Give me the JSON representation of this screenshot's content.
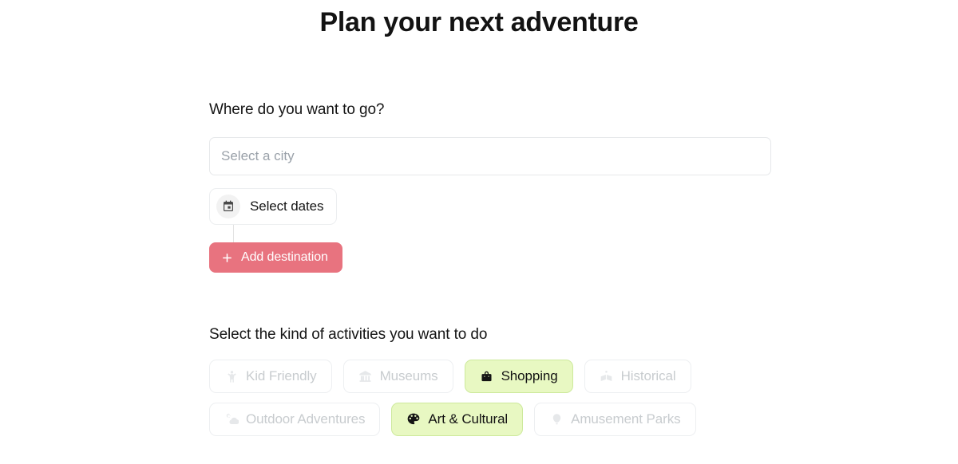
{
  "page": {
    "title": "Plan your next adventure"
  },
  "destination": {
    "label": "Where do you want to go?",
    "city_input": {
      "value": "",
      "placeholder": "Select a city"
    },
    "select_dates": {
      "label": "Select dates",
      "icon": "calendar-icon"
    },
    "add_destination": {
      "label": "Add destination",
      "icon": "plus-icon",
      "color": "#e8737f",
      "text_color": "#ffffff"
    }
  },
  "activities": {
    "label": "Select the kind of activities you want to do",
    "selected_color": "#e8f8c2",
    "selected_border_color": "#cde99c",
    "unselected_text_color": "#c8cccf",
    "chips": [
      {
        "label": "Kid Friendly",
        "icon": "child-icon",
        "selected": false
      },
      {
        "label": "Museums",
        "icon": "museum-icon",
        "selected": false
      },
      {
        "label": "Shopping",
        "icon": "shopping-bag-icon",
        "selected": true
      },
      {
        "label": "Historical",
        "icon": "open-book-icon",
        "selected": false
      },
      {
        "label": "Outdoor Adventures",
        "icon": "sun-cloud-icon",
        "selected": false
      },
      {
        "label": "Art & Cultural",
        "icon": "palette-icon",
        "selected": true
      },
      {
        "label": "Amusement Parks",
        "icon": "balloon-icon",
        "selected": false
      }
    ]
  }
}
